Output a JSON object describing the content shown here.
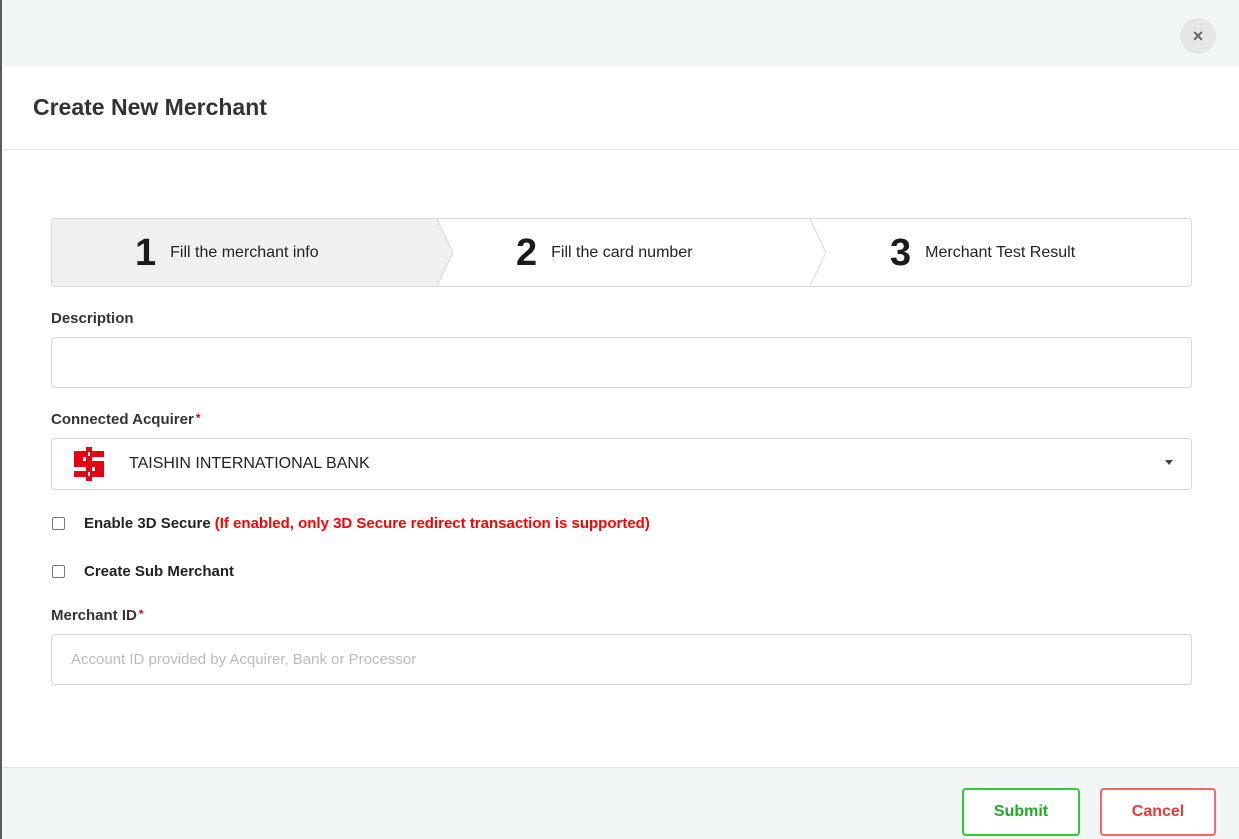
{
  "modal": {
    "close_symbol": "×",
    "close_icon": "close-icon",
    "title": "Create New Merchant"
  },
  "steps": [
    {
      "number": "1",
      "label": "Fill the merchant info",
      "active": true
    },
    {
      "number": "2",
      "label": "Fill the card number",
      "active": false
    },
    {
      "number": "3",
      "label": "Merchant Test Result",
      "active": false
    }
  ],
  "form": {
    "description": {
      "label": "Description",
      "value": "",
      "placeholder": ""
    },
    "acquirer": {
      "label": "Connected Acquirer",
      "required_mark": "*",
      "selected": "TAISHIN INTERNATIONAL BANK",
      "logo_icon": "taishin-bank-logo-icon",
      "logo_color": "#e60012"
    },
    "enable_3ds": {
      "label": "Enable 3D Secure",
      "note": "(If enabled, only 3D Secure redirect transaction is supported)",
      "checked": false,
      "note_color": "#ff0000"
    },
    "sub_merchant": {
      "label": "Create Sub Merchant",
      "checked": false
    },
    "merchant_id": {
      "label": "Merchant ID",
      "required_mark": "*",
      "value": "",
      "placeholder": "Account ID provided by Acquirer, Bank or Processor"
    }
  },
  "footer": {
    "submit_label": "Submit",
    "cancel_label": "Cancel",
    "submit_color": "#2bcc2b",
    "cancel_color": "#ff6363"
  }
}
